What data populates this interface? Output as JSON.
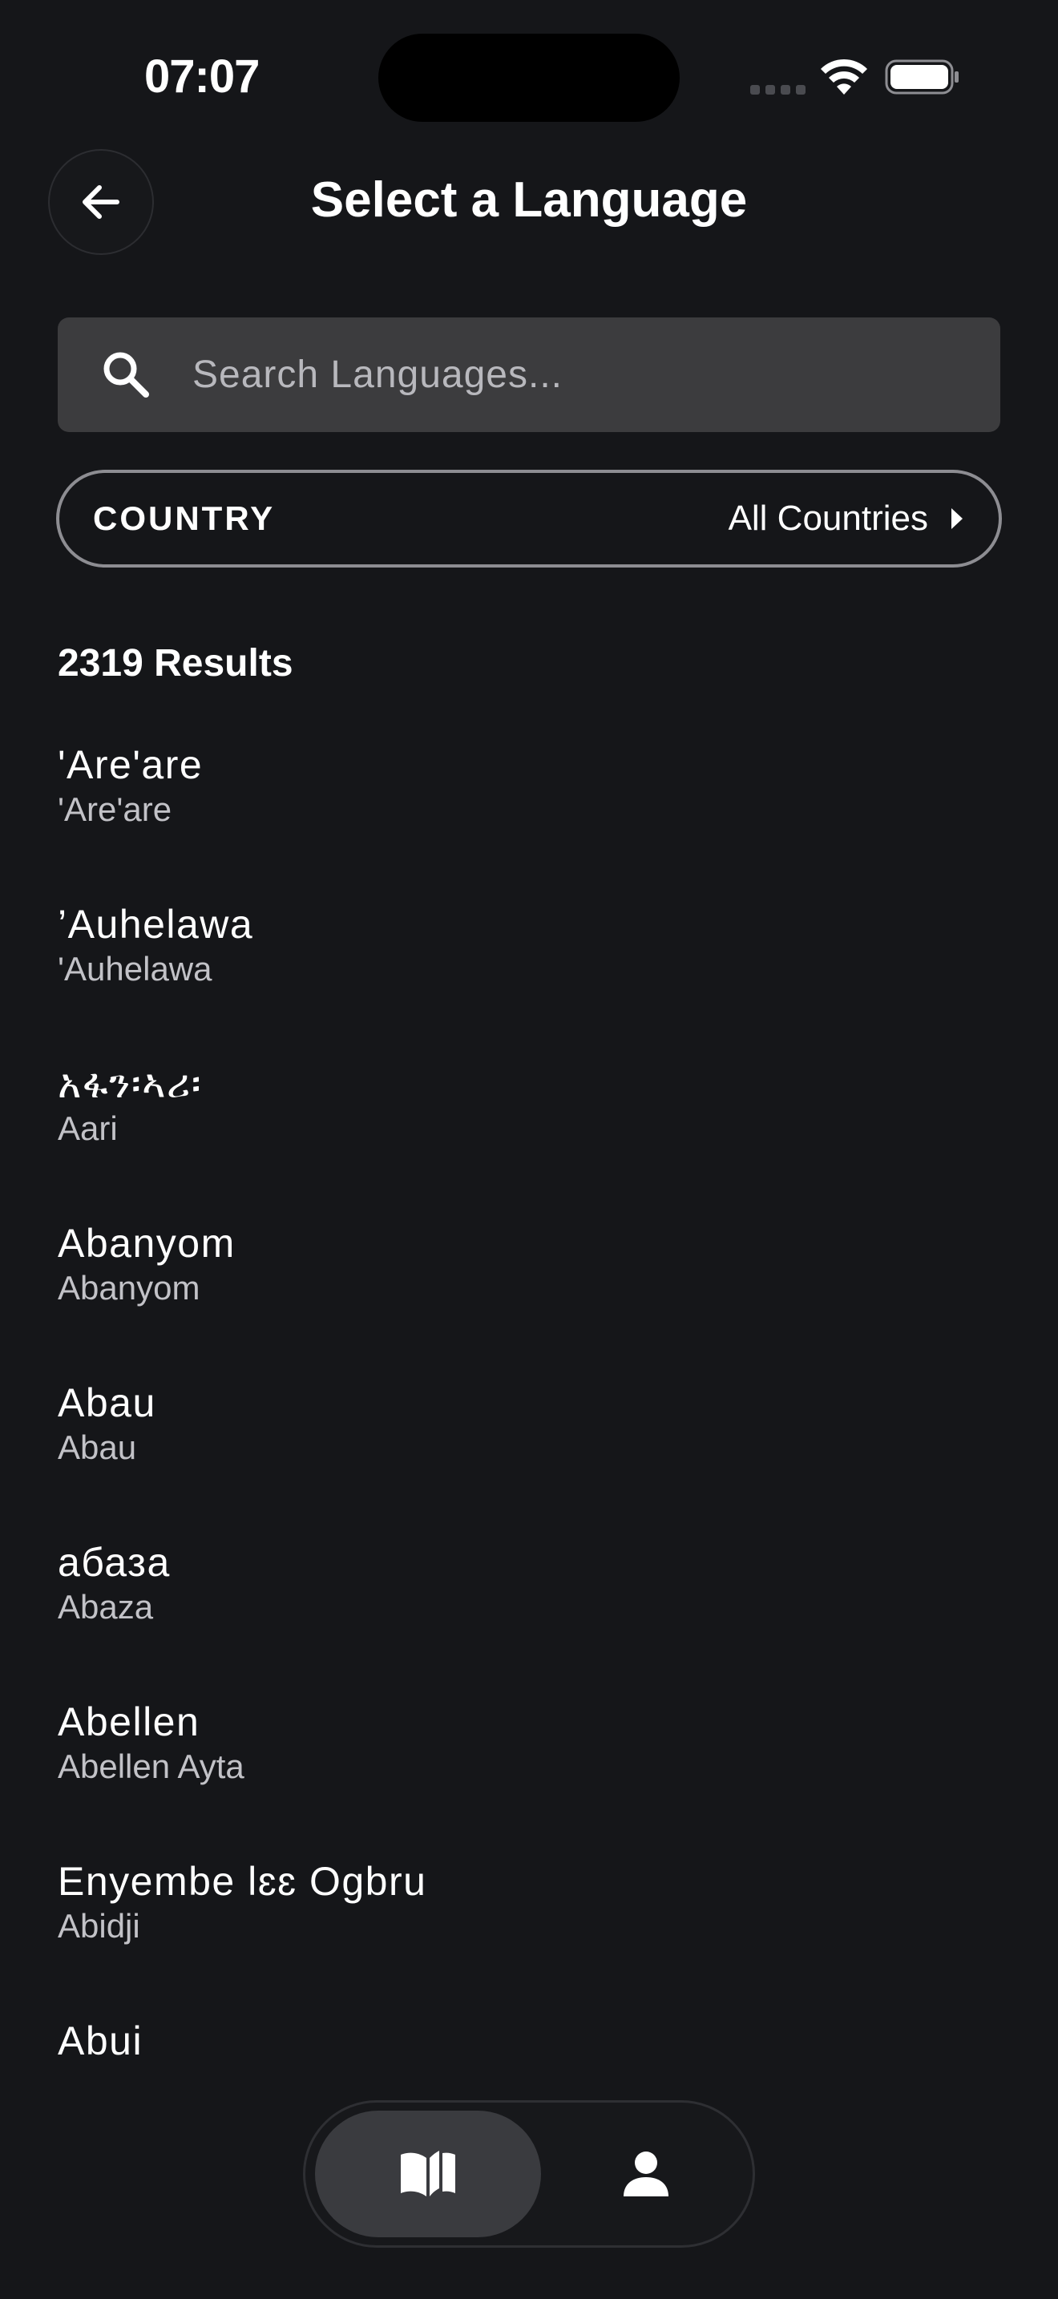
{
  "status_bar": {
    "time": "07:07"
  },
  "header": {
    "back_icon": "arrow-left-icon",
    "title": "Select a Language"
  },
  "search": {
    "icon": "search-icon",
    "placeholder": "Search Languages...",
    "value": ""
  },
  "country_filter": {
    "label": "COUNTRY",
    "value": "All Countries",
    "icon": "chevron-right-icon"
  },
  "results": {
    "count_label": "2319 Results"
  },
  "languages": [
    {
      "native": "'Are'are",
      "english": "'Are'are"
    },
    {
      "native": "’Auhelawa",
      "english": "'Auhelawa"
    },
    {
      "native": "አፋን፡ኣሪ፡",
      "english": "Aari"
    },
    {
      "native": "Abanyom",
      "english": "Abanyom"
    },
    {
      "native": "Abau",
      "english": "Abau"
    },
    {
      "native": "абаза",
      "english": "Abaza"
    },
    {
      "native": "Abellen",
      "english": "Abellen Ayta"
    },
    {
      "native": "Enyembe lɛɛ Ogbru",
      "english": "Abidji"
    },
    {
      "native": "Abui",
      "english": ""
    }
  ],
  "tab_bar": {
    "tabs": [
      {
        "icon": "book-icon",
        "selected": true
      },
      {
        "icon": "person-icon",
        "selected": false
      }
    ]
  },
  "colors": {
    "background": "#151619",
    "search_field": "#3c3c3e",
    "selected_tab": "#3a3b3f",
    "secondary_text": "#c2c2c7"
  }
}
